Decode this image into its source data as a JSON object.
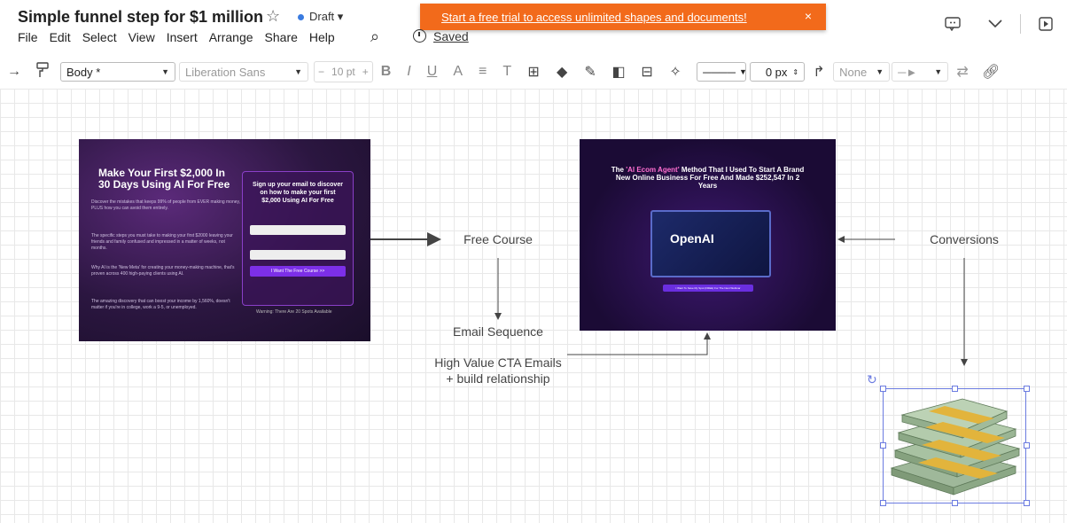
{
  "header": {
    "title": "Simple funnel step for $1 million",
    "status": "Draft",
    "saved": "Saved",
    "banner": "Start a free trial to access unlimited shapes and documents!",
    "menu": [
      "File",
      "Edit",
      "Select",
      "View",
      "Insert",
      "Arrange",
      "Share",
      "Help"
    ]
  },
  "toolbar": {
    "style": "Body *",
    "font": "Liberation Sans",
    "font_size": "10 pt",
    "line_width": "0 px",
    "arrow_start": "None"
  },
  "canvas": {
    "free_course": "Free Course",
    "email_sequence": "Email Sequence",
    "cta_line1": "High Value CTA Emails",
    "cta_line2": "+ build relationship",
    "conversions": "Conversions",
    "optin": {
      "headline": "Make Your First $2,000 In 30 Days Using AI For Free",
      "bullets": [
        "Discover the mistakes that keeps 99% of people from EVER making money, PLUS how you can avoid them entirely.",
        "The specific steps you must take to making your first $2000 leaving your friends and family confused and impressed in a matter of weeks, not months.",
        "Why AI is the 'New Meta' for creating your money-making machine, that's proven across 400 high-paying clients using AI.",
        "The amazing discovery that can boost your income by 1,560%, doesn't matter if you're in college, work a 9-5, or unemployed."
      ],
      "card_title": "Sign up your email to discover on how to make your first $2,000 Using AI For Free",
      "button": "I Want The Free Course >>",
      "warning": "Warning: There Are 20 Spots Available"
    },
    "sales": {
      "headline_pre": "The ",
      "headline_hl": "'AI Ecom Agent'",
      "headline_post": " Method That I Used To Start A Brand New Online Business For Free And Made $252,547 In 2 Years",
      "logo": "OpenAI",
      "cta": "I Want To Save My Spot (FREE) For The Next Webinar"
    }
  },
  "colors": {
    "banner": "#f26a1b",
    "selection": "#6b7be0",
    "arrow": "#444444"
  }
}
